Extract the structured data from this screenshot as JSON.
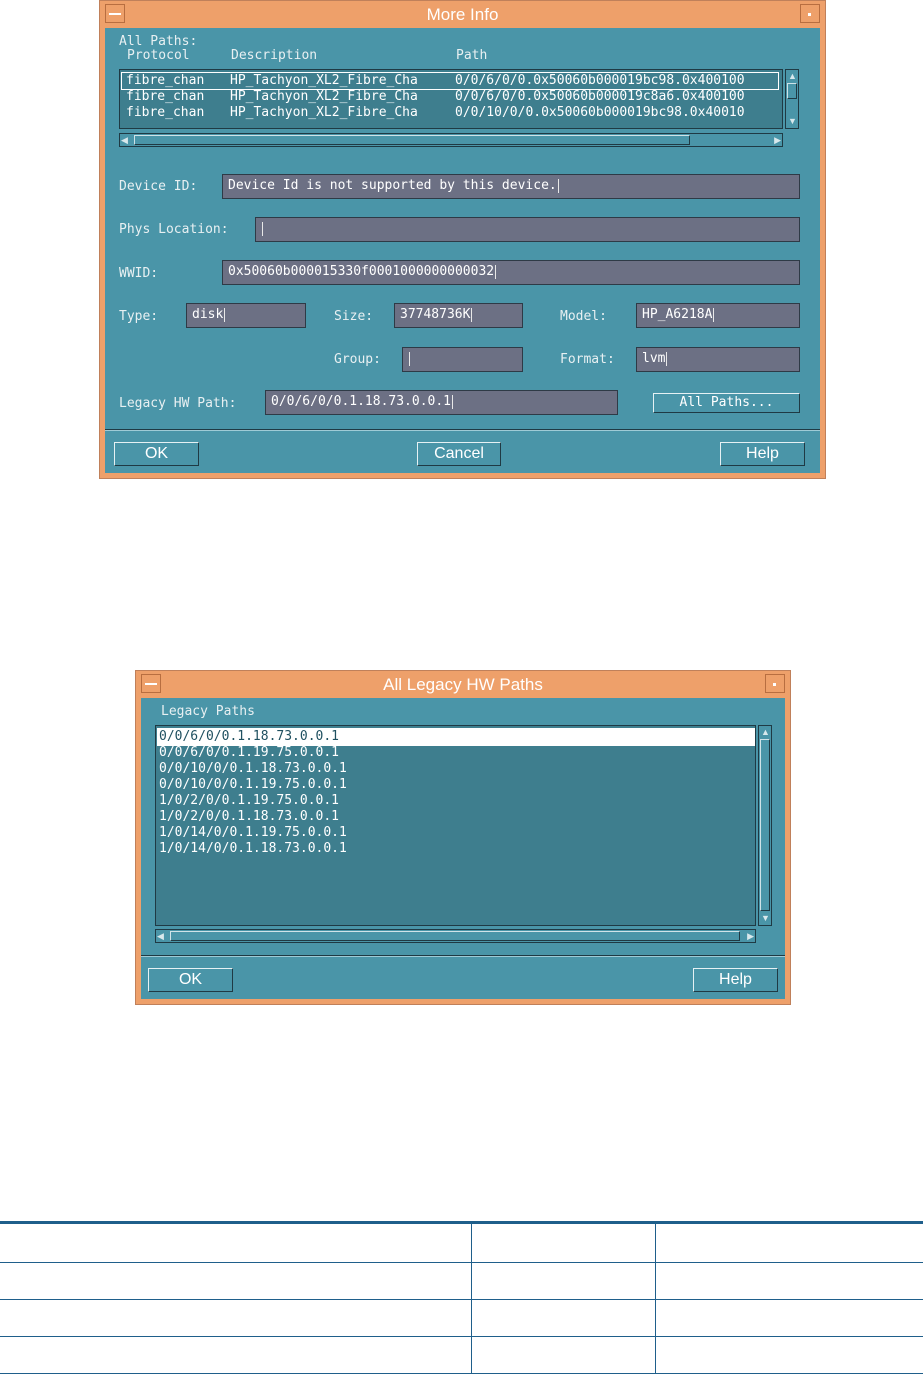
{
  "more_info": {
    "title": "More Info",
    "all_paths_label": "All Paths:",
    "columns": {
      "protocol": "Protocol",
      "description": "Description",
      "path": "Path"
    },
    "paths": [
      {
        "protocol": "fibre_chan",
        "description": "HP_Tachyon_XL2_Fibre_Cha",
        "path": "0/0/6/0/0.0x50060b000019bc98.0x400100"
      },
      {
        "protocol": "fibre_chan",
        "description": "HP_Tachyon_XL2_Fibre_Cha",
        "path": "0/0/6/0/0.0x50060b000019c8a6.0x400100"
      },
      {
        "protocol": "fibre_chan",
        "description": "HP_Tachyon_XL2_Fibre_Cha",
        "path": "0/0/10/0/0.0x50060b000019bc98.0x40010"
      }
    ],
    "device_id": {
      "label": "Device ID:",
      "value": "Device Id is not supported by this device."
    },
    "phys_location": {
      "label": "Phys Location:",
      "value": ""
    },
    "wwid": {
      "label": "WWID:",
      "value": "0x50060b000015330f0001000000000032"
    },
    "type": {
      "label": "Type:",
      "value": "disk"
    },
    "size": {
      "label": "Size:",
      "value": "37748736K"
    },
    "model": {
      "label": "Model:",
      "value": "HP_A6218A"
    },
    "group": {
      "label": "Group:",
      "value": ""
    },
    "format": {
      "label": "Format:",
      "value": "lvm"
    },
    "legacy_hw_path": {
      "label": "Legacy HW Path:",
      "value": "0/0/6/0/0.1.18.73.0.0.1"
    },
    "all_paths_button": "All Paths...",
    "ok": "OK",
    "cancel": "Cancel",
    "help": "Help"
  },
  "legacy": {
    "title": "All Legacy HW Paths",
    "list_label": "Legacy Paths",
    "paths": [
      "0/0/6/0/0.1.18.73.0.0.1",
      "0/0/6/0/0.1.19.75.0.0.1",
      "0/0/10/0/0.1.18.73.0.0.1",
      "0/0/10/0/0.1.19.75.0.0.1",
      "1/0/2/0/0.1.19.75.0.0.1",
      "1/0/2/0/0.1.18.73.0.0.1",
      "1/0/14/0/0.1.19.75.0.0.1",
      "1/0/14/0/0.1.18.73.0.0.1"
    ],
    "ok": "OK",
    "help": "Help"
  },
  "colors": {
    "dialog_bg": "#4a95a8",
    "frame": "#eea06a",
    "field": "#6c7084",
    "table_rule": "#1f5f8b"
  }
}
